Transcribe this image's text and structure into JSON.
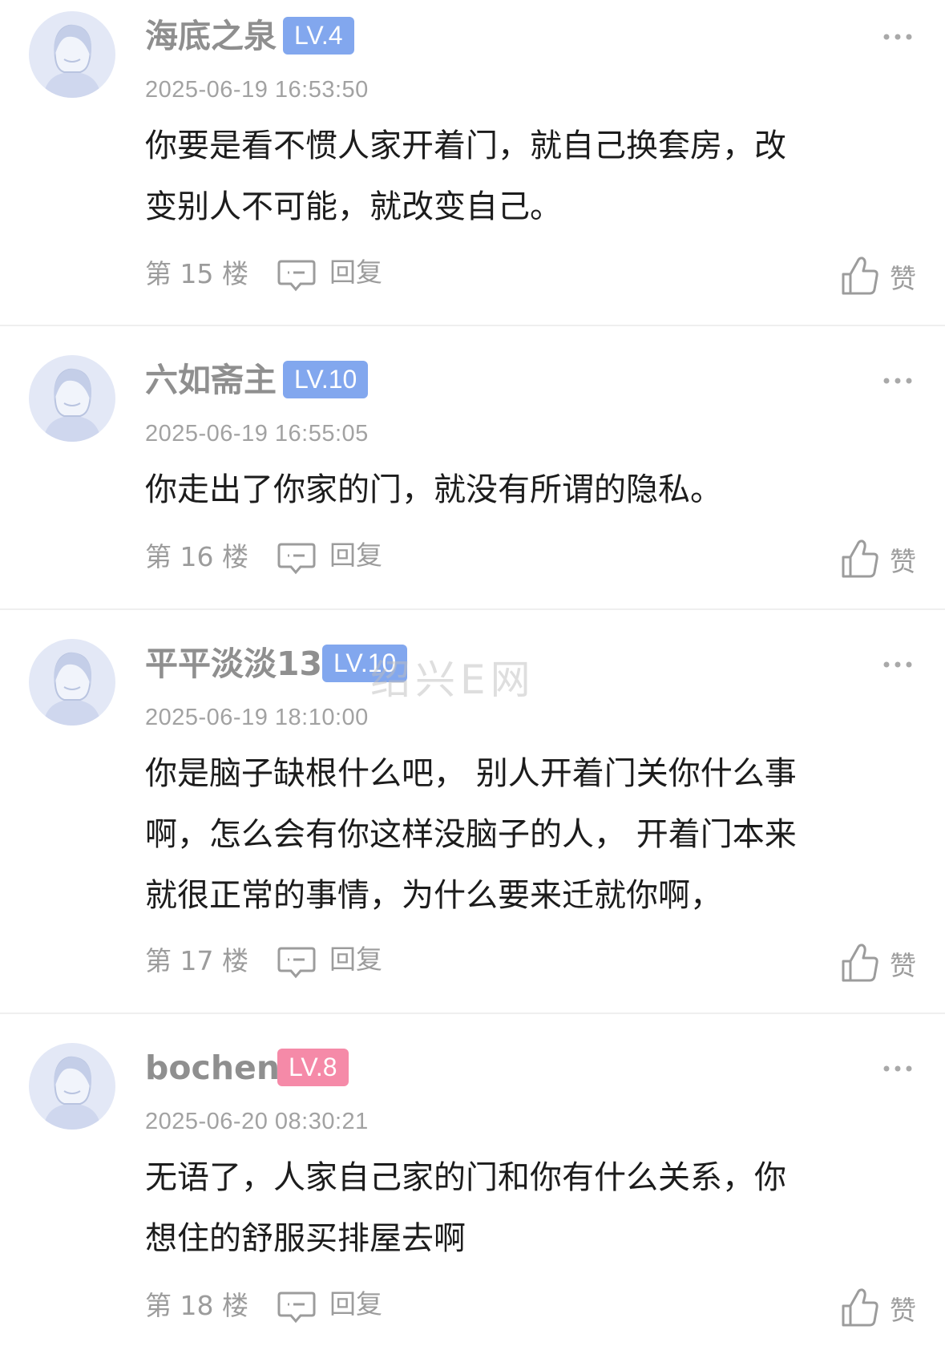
{
  "comments": [
    {
      "username": "海底之泉",
      "level": "LV.4",
      "time": "2025-06-19 16:53:50",
      "content": [
        "你要是看不惯人家开着门，就自己换套房，改",
        "变别人不可能，就改变自己。"
      ],
      "floor": "第 15 楼",
      "reply": "回复",
      "like": "赞"
    },
    {
      "username": "六如斋主",
      "level": "LV.10",
      "time": "2025-06-19 16:55:05",
      "content": [
        "你走出了你家的门，就没有所谓的隐私。"
      ],
      "floor": "第 16 楼",
      "reply": "回复",
      "like": "赞"
    },
    {
      "username": "平平淡淡13",
      "level": "LV.10",
      "time": "2025-06-19 18:10:00",
      "content": [
        "你是脑子缺根什么吧， 别人开着门关你什么事",
        "啊，怎么会有你这样没脑子的人，   开着门本来",
        "就很正常的事情，为什么要来迁就你啊，"
      ],
      "floor": "第 17 楼",
      "reply": "回复",
      "like": "赞"
    },
    {
      "username": "bochen",
      "level": "LV.8",
      "time": "2025-06-20 08:30:21",
      "content": [
        "无语了，人家自己家的门和你有什么关系，你",
        "想住的舒服买排屋去啊"
      ],
      "floor": "第 18 楼",
      "reply": "回复",
      "like": "赞"
    }
  ],
  "icons": {
    "avatar": "default-user-avatar",
    "more": "more-dots-icon",
    "reply": "reply-bubble-icon",
    "like": "thumbs-up-icon"
  },
  "colors": {
    "badge_blue": "#82a7ee",
    "badge_pink": "#f58aa8",
    "username": "#8f8f8f",
    "text": "#1c1c1c",
    "meta": "#9c9c9c"
  },
  "watermark": "绍兴E网"
}
